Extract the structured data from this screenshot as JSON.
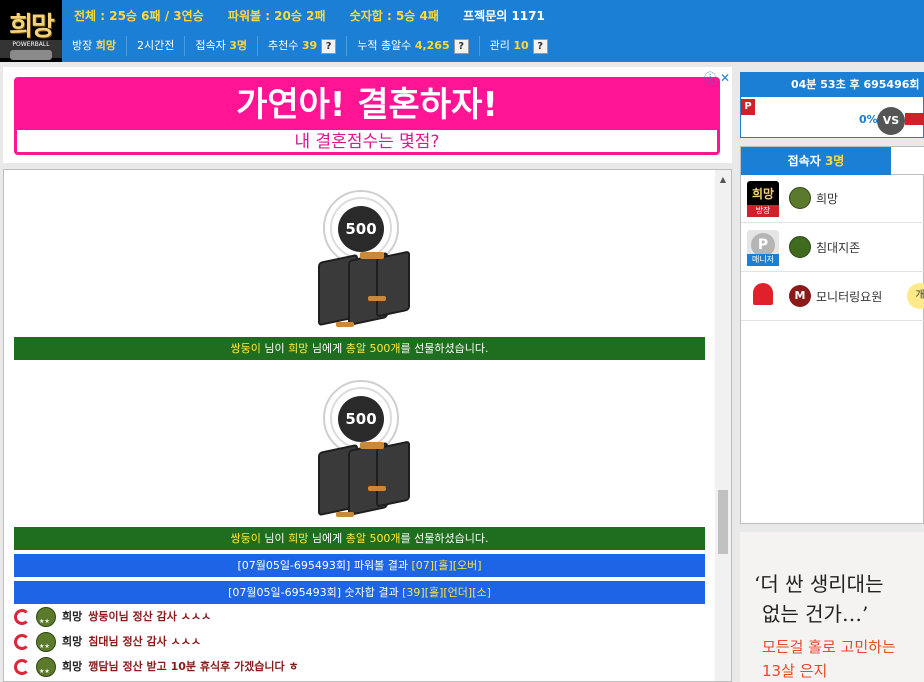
{
  "header": {
    "logo_text": "희망",
    "logo_sub": "POWERBALL PICKSTER",
    "stats": {
      "total": "전체 : 25승 6패 / 3연승",
      "powerball": "파워볼 : 20승 2패",
      "number_sum": "숫자합 : 5승 4패",
      "special_label": "프젝문의 1171"
    },
    "info": {
      "owner_label": "방장",
      "owner_name": "희망",
      "time_ago": "2시간전",
      "visitors_label": "접속자",
      "visitors_count": "3명",
      "recommend_label": "추천수",
      "recommend_count": "39",
      "gift_label": "누적 총알수",
      "gift_count": "4,265",
      "manage_label": "관리",
      "manage_count": "10",
      "help": "?"
    }
  },
  "ad": {
    "headline": "가연아! 결혼하자!",
    "subline": "내 결혼점수는 몇점?",
    "icons": "ⓘ ✕"
  },
  "chat": {
    "gift_image_label": "500",
    "gift_messages": [
      {
        "sender": "쌍둥이",
        "mid1": " 님이 ",
        "receiver": "희망",
        "mid2": " 님에게 ",
        "item": "총알 500개",
        "suffix": "를 선물하셨습니다."
      },
      {
        "sender": "쌍둥이",
        "mid1": " 님이 ",
        "receiver": "희망",
        "mid2": " 님에게 ",
        "item": "총알 500개",
        "suffix": "를 선물하셨습니다."
      }
    ],
    "results": [
      {
        "prefix": "[07월05일-695493회]",
        "label": " 파워볼 결과 ",
        "value": "[07][홀][오버]"
      },
      {
        "prefix": "[07월05일-695493회]",
        "label": " 숫자합 결과 ",
        "value": "[39][홀][언더][소]"
      }
    ],
    "lines": [
      {
        "nick": "희망",
        "msg": "쌍둥이님 정산 감사 ㅅㅅㅅ"
      },
      {
        "nick": "희망",
        "msg": "침대님 정산 감사 ㅅㅅㅅ"
      },
      {
        "nick": "희망",
        "msg": "깽담님 정산 받고 10분 휴식후 가겠습니다 ㅎ"
      }
    ]
  },
  "right_panel": {
    "countdown": "04분 53초 후 695496회",
    "p_label": "P",
    "percent": "0%",
    "vs": "VS",
    "users_tab_label": "접속자",
    "users_tab_count": "3명",
    "users": [
      {
        "name": "희망",
        "badge": "방장",
        "avatar_text": "희망"
      },
      {
        "name": "침대지존",
        "badge": "매니저",
        "avatar_text": "P"
      },
      {
        "name": "모니터링요원",
        "badge": "",
        "avatar_text": "",
        "extra": "개"
      }
    ],
    "ad": {
      "line1": "‘더 싼 생리대는",
      "line2": "없는 건가…’",
      "line3": "모든걸 홀로 고민하는",
      "line4": "13살 은지"
    }
  }
}
